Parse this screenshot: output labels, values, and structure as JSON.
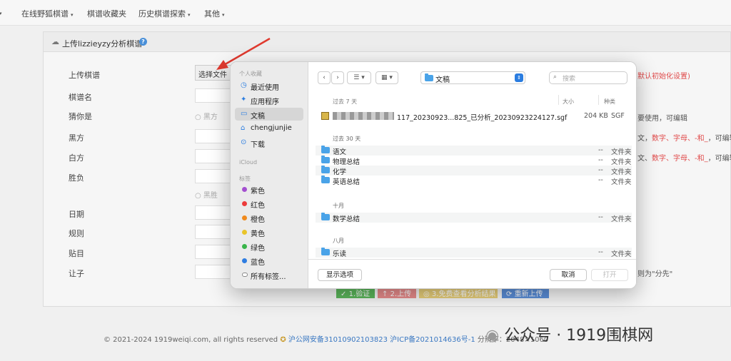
{
  "nav": {
    "items": [
      {
        "label": "在线野狐棋谱",
        "caret": "▾"
      },
      {
        "label": "棋谱收藏夹",
        "caret": ""
      },
      {
        "label": "历史棋谱探索",
        "caret": "▾"
      },
      {
        "label": "其他",
        "caret": "▾"
      }
    ]
  },
  "panel": {
    "title": "上传lizzieyzy分析棋谱",
    "help": "?",
    "labels": [
      "上传棋谱",
      "棋谱名",
      "猜你是",
      "黑方",
      "白方",
      "胜负",
      "日期",
      "规则",
      "贴目",
      "让子"
    ],
    "file_button": "选择文件",
    "radio_black": "黑方",
    "radio_black_win": "黑胜",
    "hints": {
      "h1": "默认初始化设置)",
      "h2": "要使用，可编辑",
      "h3a": "文，",
      "h3b": "数字、字母、-和_",
      "h3c": "，可编辑",
      "h4a": "文、",
      "h4b": "数字、字母、-和_",
      "h4c": "，可编辑",
      "h5": "则为\"分先\""
    },
    "actions": [
      "1.验证",
      "2.上传",
      "3.免费查看分析结果",
      "重新上传"
    ],
    "colors": {
      "green": "#5cb85c",
      "red": "#e88c8c",
      "yellow": "#e8cf7a",
      "blue": "#5b8fd9"
    }
  },
  "footer": {
    "copyright": "© 2021-2024 1919weiqi.com, all rights reserved",
    "police": "沪公网安备31010902103823",
    "icp": "沪ICP备2021014636号-1",
    "extra": "分辨率：2048×1060"
  },
  "watermark": "公众号 · 1919围棋网",
  "dialog": {
    "sidebar": {
      "favorites_head": "个人收藏",
      "favorites": [
        {
          "label": "最近使用",
          "icon": "clock-icon",
          "glyph": "◷"
        },
        {
          "label": "应用程序",
          "icon": "apps-icon",
          "glyph": "✦"
        },
        {
          "label": "文稿",
          "icon": "document-icon",
          "glyph": "▭"
        },
        {
          "label": "chengjunjie",
          "icon": "home-icon",
          "glyph": "⌂"
        },
        {
          "label": "下载",
          "icon": "download-icon",
          "glyph": "⊙"
        }
      ],
      "icloud_head": "iCloud",
      "tags_head": "标签",
      "tags": [
        {
          "label": "紫色",
          "color": "#a34fd0"
        },
        {
          "label": "红色",
          "color": "#ec3b3b"
        },
        {
          "label": "橙色",
          "color": "#f08a1d"
        },
        {
          "label": "黄色",
          "color": "#e9c429"
        },
        {
          "label": "绿色",
          "color": "#39b54a"
        },
        {
          "label": "蓝色",
          "color": "#2f7de1"
        },
        {
          "label": "所有标签...",
          "color": ""
        }
      ]
    },
    "toolbar": {
      "back": "‹",
      "forward": "›",
      "list_view": "☰ ▾",
      "grid_view": "▦ ▾",
      "location": "文稿",
      "search_placeholder": "搜索"
    },
    "columns": {
      "name": "过去 7 天",
      "size": "大小",
      "kind": "种类"
    },
    "groups": [
      {
        "title": "",
        "items": [
          {
            "name": "117_20230923...825_已分析_20230923224127.sgf",
            "size": "204 KB",
            "kind": "SGF",
            "type": "sgf"
          }
        ]
      },
      {
        "title": "过去 30 天",
        "items": [
          {
            "name": "语文",
            "size": "--",
            "kind": "文件夹",
            "type": "folder"
          },
          {
            "name": "物理总结",
            "size": "--",
            "kind": "文件夹",
            "type": "folder"
          },
          {
            "name": "化学",
            "size": "--",
            "kind": "文件夹",
            "type": "folder"
          },
          {
            "name": "英语总结",
            "size": "--",
            "kind": "文件夹",
            "type": "folder"
          }
        ]
      },
      {
        "title": "十月",
        "items": [
          {
            "name": "数学总结",
            "size": "--",
            "kind": "文件夹",
            "type": "folder"
          }
        ]
      },
      {
        "title": "八月",
        "items": [
          {
            "name": "乐读",
            "size": "--",
            "kind": "文件夹",
            "type": "folder"
          }
        ]
      }
    ],
    "buttons": {
      "options": "显示选项",
      "cancel": "取消",
      "open": "打开"
    }
  }
}
